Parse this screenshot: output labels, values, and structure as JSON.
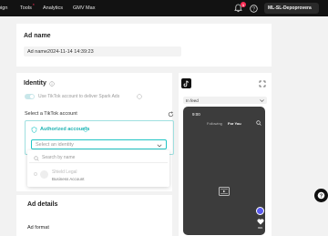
{
  "topbar": {
    "nav": [
      "oign",
      "Tools",
      "Analytics",
      "GMV Max"
    ],
    "tools_marker": "*",
    "notif_badge": "1",
    "account_name": "ML-SL-Depoprovera"
  },
  "ad_name": {
    "title": "Ad name",
    "value": "Ad name2024-11-14 14:39:23"
  },
  "identity": {
    "title": "Identity",
    "spark_toggle_label": "Use TikTok account to deliver Spark Ads",
    "select_label": "Select a TikTok account",
    "authorized_label": "Authorized accounts",
    "select_placeholder": "Select an identity",
    "search_placeholder": "Search by name",
    "option_name": "Shield Legal",
    "option_type": "Business Account"
  },
  "ad_details": {
    "title": "Ad details",
    "format_label": "Ad format"
  },
  "preview": {
    "placement": "In feed",
    "time": "9:00",
    "tab_following": "Following",
    "tab_foryou": "For You",
    "like_count": "999"
  },
  "colors": {
    "accent": "#20c5c5",
    "brand": "#fe2c55",
    "topbar": "#121212"
  }
}
